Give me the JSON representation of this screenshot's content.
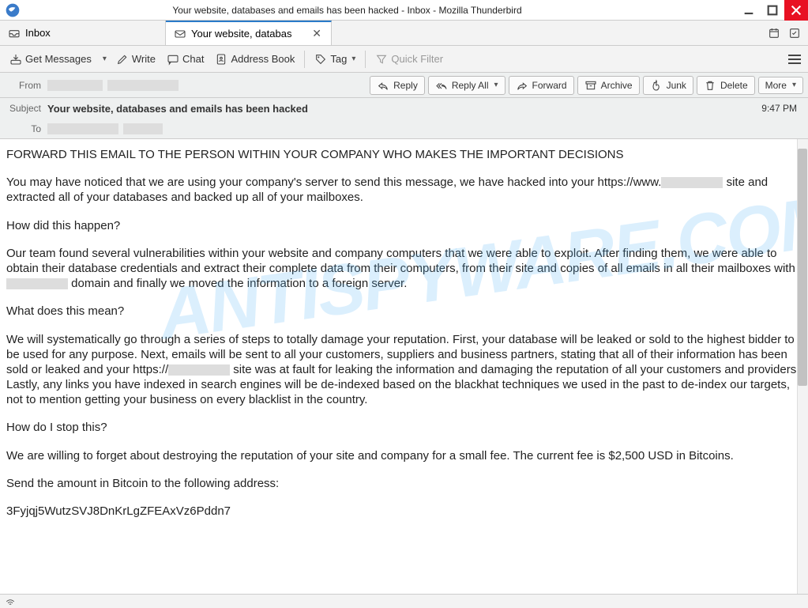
{
  "window": {
    "title": "Your website, databases and emails has been hacked - Inbox - Mozilla Thunderbird"
  },
  "tabs": {
    "inbox": "Inbox",
    "active": "Your website, databas"
  },
  "toolbar": {
    "get_messages": "Get Messages",
    "write": "Write",
    "chat": "Chat",
    "address_book": "Address Book",
    "tag": "Tag",
    "quick_filter": "Quick Filter"
  },
  "headers": {
    "from_label": "From",
    "subject_label": "Subject",
    "to_label": "To",
    "subject": "Your website, databases and emails has been hacked",
    "time": "9:47 PM"
  },
  "actions": {
    "reply": "Reply",
    "reply_all": "Reply All",
    "forward": "Forward",
    "archive": "Archive",
    "junk": "Junk",
    "delete": "Delete",
    "more": "More"
  },
  "email": {
    "p1": "FORWARD THIS EMAIL TO THE PERSON WITHIN YOUR COMPANY WHO MAKES THE IMPORTANT DECISIONS",
    "p2a": "You may have noticed that we are using your company's server to send this message, we have hacked into your https://www.",
    "p2b": " site and extracted all of your databases and backed up all of your mailboxes.",
    "p3": "How did this happen?",
    "p4a": "Our team found several vulnerabilities within your website and company computers that we were able to exploit. After finding them, we were able to obtain their database credentials and extract their complete data from their computers, from their site and copies of all emails in all their mailboxes with ",
    "p4b": " domain and finally we moved the information to a foreign server.",
    "p5": "What does this mean?",
    "p6a": "We will systematically go through a series of steps to totally damage your reputation. First, your database will be leaked or sold to the highest bidder to be used for any purpose. Next, emails will be sent to all your customers, suppliers and business partners, stating that all of their information has been sold or leaked and your https://",
    "p6b": " site was at fault for leaking the information and damaging the reputation of all your customers and providers. Lastly, any links you have indexed in search engines will be de-indexed based on the blackhat techniques we used in the past to de-index our targets, not to mention getting your business on every blacklist in the country.",
    "p7": "How do I stop this?",
    "p8": "We are willing to forget about destroying the reputation of your site and company for a small fee. The current fee is $2,500 USD in Bitcoins.",
    "p9": "Send the amount in Bitcoin to the following address:",
    "p10": "3Fyjqj5WutzSVJ8DnKrLgZFEAxVz6Pddn7"
  },
  "watermark": "ANTISPYWARE.COM"
}
